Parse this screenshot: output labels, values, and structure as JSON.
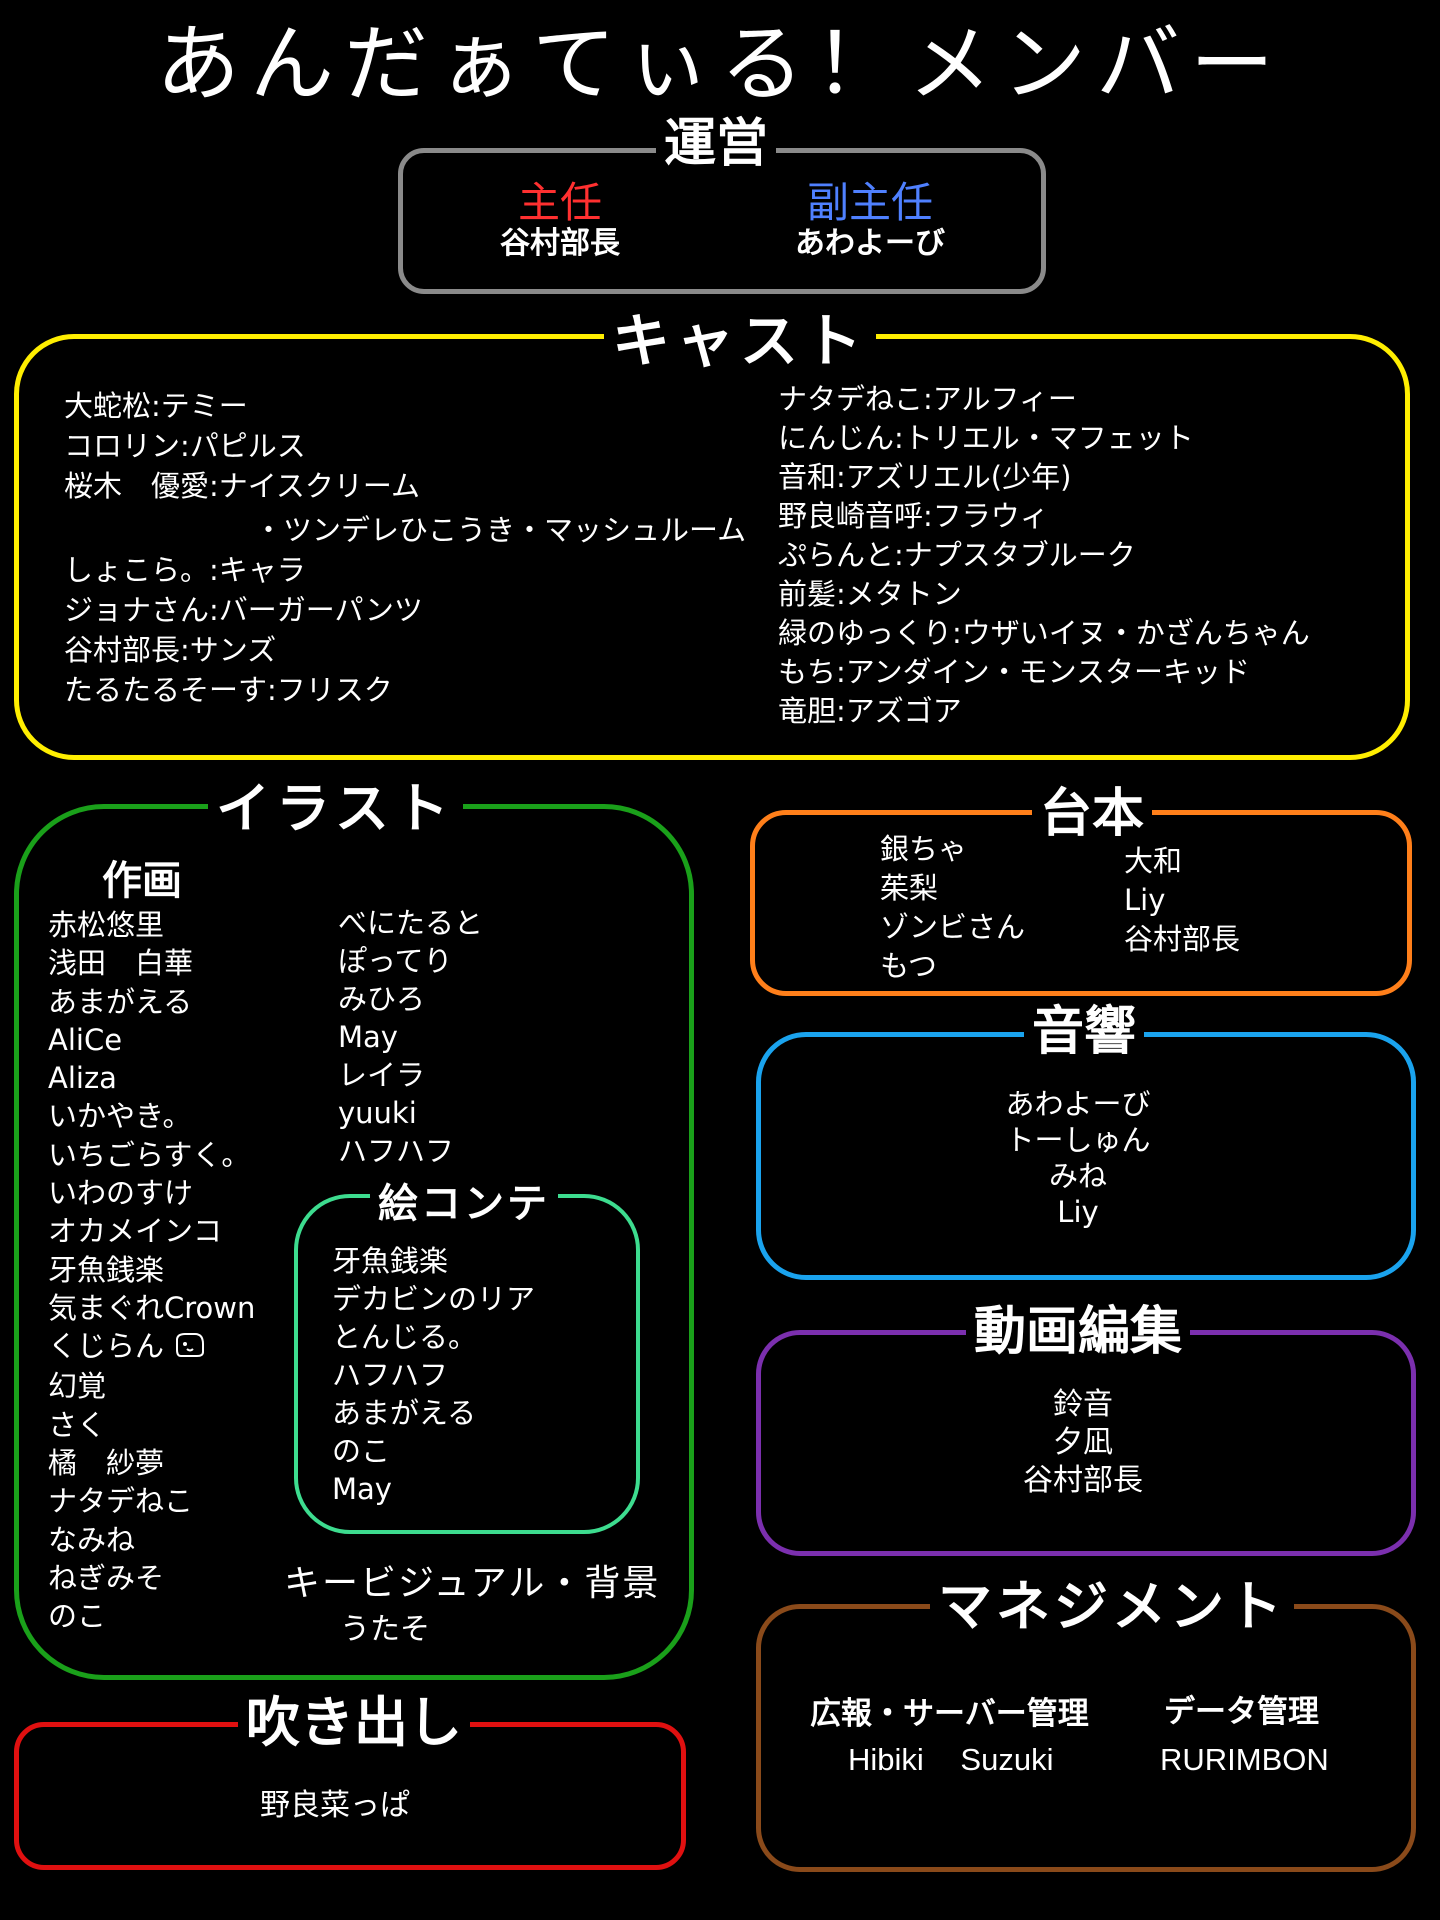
{
  "title": "あんだぁてぃる！メンバー",
  "colors": {
    "unei": "#8a8a8a",
    "cast": "#ffee00",
    "illust": "#1aa01a",
    "ekonte": "#3ddc8f",
    "daihon": "#ff7f1a",
    "onkyo": "#1aa3ee",
    "douga": "#7b2fae",
    "fukidashi": "#e01010",
    "management": "#8a4a1a",
    "shunin": "#ff3030",
    "fukushunin": "#4f80ff"
  },
  "unei": {
    "heading": "運営",
    "shunin_role": "主任",
    "shunin_name": "谷村部長",
    "fukushunin_role": "副主任",
    "fukushunin_name": "あわよーび"
  },
  "cast": {
    "heading": "キャスト",
    "left": [
      "大蛇松:テミー",
      "コロリン:パピルス",
      "桜木　優愛:ナイスクリーム",
      "・ツンデレひこうき・マッシュルーム",
      "しょこら。:キャラ",
      "ジョナさん:バーガーパンツ",
      "谷村部長:サンズ",
      "たるたるそーす:フリスク"
    ],
    "right": [
      "ナタデねこ:アルフィー",
      "にんじん:トリエル・マフェット",
      "音和:アズリエル(少年)",
      "野良崎音呼:フラウィ",
      "ぷらんと:ナプスタブルーク",
      "前髪:メタトン",
      "緑のゆっくり:ウザいイヌ・かざんちゃん",
      "もち:アンダイン・モンスターキッド",
      "竜胆:アズゴア"
    ]
  },
  "illust": {
    "heading": "イラスト",
    "sakuga_label": "作画",
    "col1": [
      "赤松悠里",
      "浅田　白華",
      "あまがえる",
      "AliCe",
      "Aliza",
      "いかやき。",
      "いちごらすく。",
      "いわのすけ",
      "オカメインコ",
      "牙魚銭楽",
      "気まぐれCrown",
      "くじらん",
      "幻覚",
      "さく",
      "橘　紗夢",
      "ナタデねこ",
      "なみね",
      "ねぎみそ",
      "のこ"
    ],
    "col2": [
      "べにたると",
      "ぽってり",
      "みひろ",
      "May",
      "レイラ",
      "yuuki",
      "ハフハフ"
    ],
    "ekonte_heading": "絵コンテ",
    "ekonte": [
      "牙魚銭楽",
      "デカビンのリア",
      "とんじる。",
      "ハフハフ",
      "あまがえる",
      "のこ",
      "May"
    ],
    "keyvisual_label": "キービジュアル・背景",
    "keyvisual_name": "うたそ"
  },
  "daihon": {
    "heading": "台本",
    "left": [
      "銀ちゃ",
      "茱梨",
      "ゾンビさん",
      "もつ"
    ],
    "right": [
      "大和",
      "Liy",
      "谷村部長"
    ]
  },
  "onkyo": {
    "heading": "音響",
    "names": [
      "あわよーび",
      "トーしゅん",
      "みね",
      "Liy"
    ]
  },
  "douga": {
    "heading": "動画編集",
    "names": [
      "鈴音",
      "夕凪",
      "谷村部長"
    ]
  },
  "fukidashi": {
    "heading": "吹き出し",
    "names": [
      "野良菜っぱ"
    ]
  },
  "management": {
    "heading": "マネジメント",
    "pr_label": "広報・サーバー管理",
    "pr_names": [
      "Hibiki",
      "Suzuki"
    ],
    "data_label": "データ管理",
    "data_name": "RURIMBON"
  }
}
